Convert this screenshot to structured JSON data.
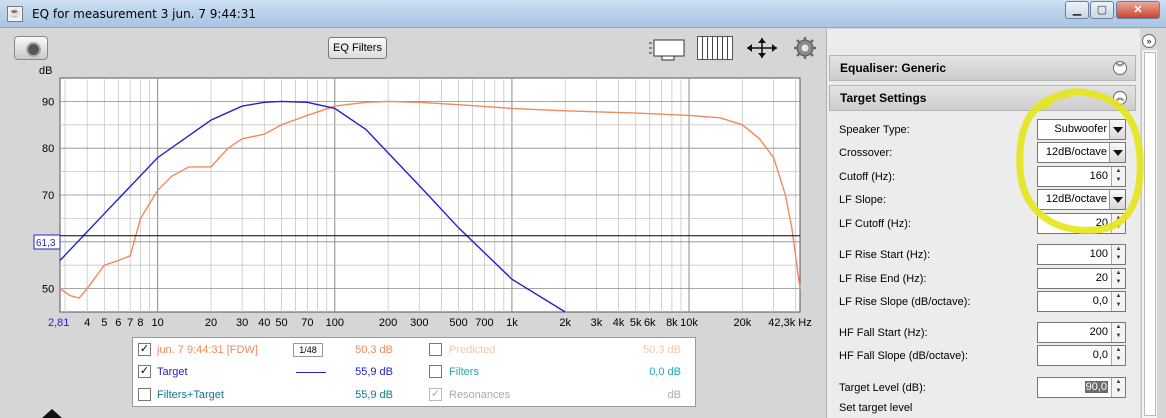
{
  "window": {
    "title": "EQ for measurement 3 jun. 7 9:44:31"
  },
  "toolbar": {
    "eq_filters_label": "EQ Filters"
  },
  "chart": {
    "y_unit": "dB",
    "y_ticks": [
      "90",
      "80",
      "70",
      "60",
      "50"
    ],
    "x_ticks": [
      "2,81",
      "4",
      "5",
      "6",
      "7",
      "8",
      "10",
      "20",
      "30",
      "40",
      "50",
      "70",
      "100",
      "200",
      "300",
      "500",
      "700",
      "1k",
      "2k",
      "3k",
      "4k",
      "5k",
      "6k",
      "8k",
      "10k",
      "20k",
      "42,3k Hz"
    ],
    "cursor_readout": "61,3"
  },
  "chart_data": {
    "type": "line",
    "x_scale": "log",
    "xlim": [
      2.81,
      42300
    ],
    "ylim": [
      45,
      95
    ],
    "ylabel": "dB",
    "series": [
      {
        "name": "jun. 7 9:44:31 [FDW]",
        "color": "#f08a5d",
        "x": [
          2.81,
          3.2,
          3.6,
          4,
          5,
          6,
          7,
          8,
          10,
          12,
          15,
          20,
          25,
          30,
          40,
          50,
          70,
          100,
          150,
          200,
          300,
          500,
          1000,
          2000,
          5000,
          10000,
          15000,
          20000,
          25000,
          30000,
          35000,
          38000,
          42300
        ],
        "y": [
          50,
          48.5,
          48,
          50,
          55,
          56,
          57,
          65,
          71,
          74,
          76,
          76,
          80,
          82,
          83,
          85,
          87,
          89,
          89.8,
          90,
          89.8,
          89.3,
          88.5,
          88,
          87.5,
          87,
          86.5,
          85,
          82,
          78,
          70,
          63,
          50
        ]
      },
      {
        "name": "Target",
        "color": "#2222cc",
        "x": [
          2.81,
          5,
          10,
          20,
          30,
          40,
          50,
          70,
          100,
          150,
          200,
          300,
          500,
          1000,
          2000
        ],
        "y": [
          56,
          66,
          78,
          86,
          89,
          89.8,
          90,
          89.8,
          88.5,
          84,
          79,
          72,
          63,
          52,
          44
        ]
      },
      {
        "name": "Target Level",
        "color": "#000000",
        "x": [
          2.81,
          42300
        ],
        "y": [
          61.3,
          61.3
        ]
      }
    ]
  },
  "legend": {
    "rows": [
      {
        "label": "jun. 7 9:44:31 [FDW]",
        "checked": true,
        "value": "50,3 dB",
        "smoothing": "1/48",
        "color": "#f08a5d"
      },
      {
        "label": "Target",
        "checked": true,
        "value": "55,9 dB",
        "color": "#2222cc"
      },
      {
        "label": "Filters+Target",
        "checked": false,
        "value": "55,9 dB",
        "color": "#107a8a"
      },
      {
        "label": "Predicted",
        "checked": false,
        "value": "50,3 dB",
        "color": "#f3c8a8"
      },
      {
        "label": "Filters",
        "checked": false,
        "value": "0,0 dB",
        "color": "#20a8b0"
      },
      {
        "label": "Resonances",
        "checked": true,
        "value": "dB",
        "color": "#aaaaaa"
      }
    ]
  },
  "equaliser": {
    "title": "Equaliser: Generic"
  },
  "target_settings": {
    "title": "Target Settings",
    "speaker_type_label": "Speaker Type:",
    "speaker_type": "Subwoofer",
    "crossover_label": "Crossover:",
    "crossover": "12dB/octave",
    "cutoff_label": "Cutoff (Hz):",
    "cutoff": "160",
    "lf_slope_label": "LF Slope:",
    "lf_slope": "12dB/octave",
    "lf_cutoff_label": "LF Cutoff (Hz):",
    "lf_cutoff": "20",
    "lf_rise_start_label": "LF Rise Start (Hz):",
    "lf_rise_start": "100",
    "lf_rise_end_label": "LF Rise End (Hz):",
    "lf_rise_end": "20",
    "lf_rise_slope_label": "LF Rise Slope (dB/octave):",
    "lf_rise_slope": "0,0",
    "hf_fall_start_label": "HF Fall Start (Hz):",
    "hf_fall_start": "200",
    "hf_fall_slope_label": "HF Fall Slope (dB/octave):",
    "hf_fall_slope": "0,0",
    "target_level_label": "Target Level (dB):",
    "target_level": "90,0",
    "set_target_level": "Set target level"
  },
  "annotation_color": "#e6e61a"
}
